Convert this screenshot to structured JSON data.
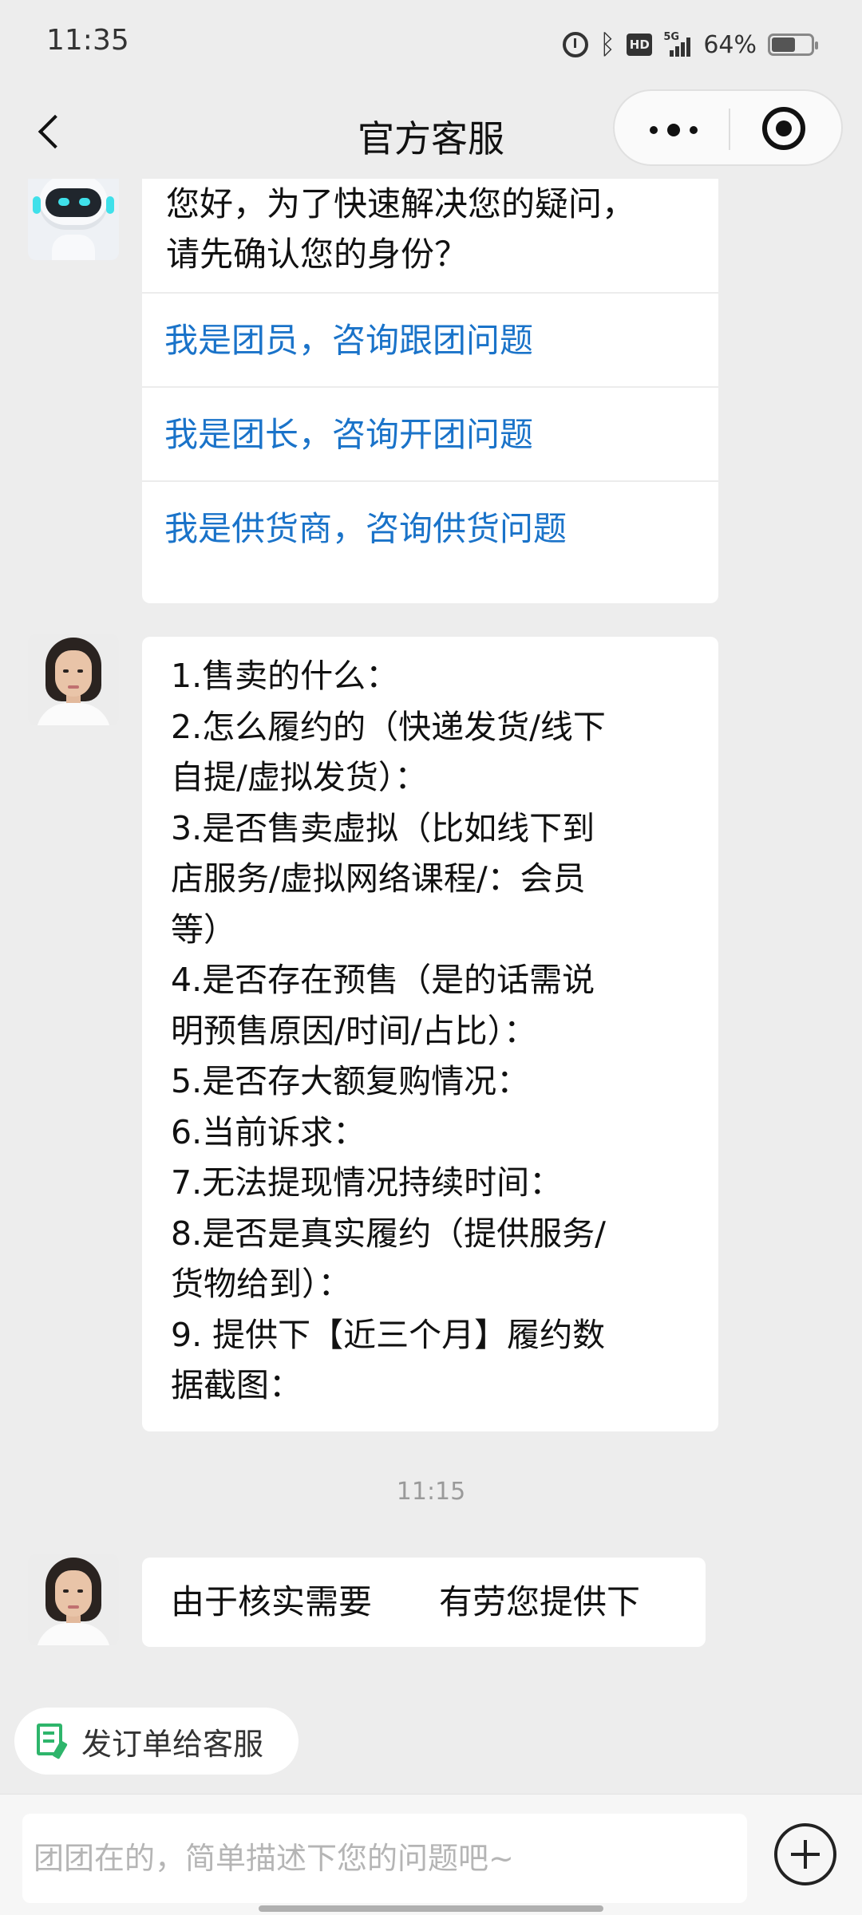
{
  "status_bar": {
    "time": "11:35",
    "network": "5G",
    "hd_label": "HD",
    "battery": "64%",
    "battery_level": 0.64,
    "icons": [
      "alarm-icon",
      "bluetooth-icon",
      "hd-icon",
      "signal-icon",
      "battery-icon"
    ]
  },
  "nav": {
    "title": "官方客服",
    "back_icon": "chevron-left-icon",
    "more_icon": "more-dots-icon",
    "close_icon": "target-close-icon"
  },
  "messages": {
    "greeting": {
      "line1": "您好，为了快速解决您的疑问，",
      "line2": "请先确认您的身份？",
      "options": [
        "我是团员，咨询跟团问题",
        "我是团长，咨询开团问题",
        "我是供货商，咨询供货问题"
      ]
    },
    "checklist": [
      "1.售卖的什么：",
      "2.怎么履约的（快递发货/线下",
      "自提/虚拟发货）：",
      "3.是否售卖虚拟（比如线下到",
      "店服务/虚拟网络课程/：会员",
      "等）",
      "4.是否存在预售（是的话需说",
      "明预售原因/时间/占比）：",
      "5.是否存大额复购情况：",
      "6.当前诉求：",
      "7.无法提现情况持续时间：",
      "8.是否是真实履约（提供服务/",
      "货物给到）：",
      "9.  提供下【近三个月】履约数",
      "据截图："
    ],
    "timestamp": "11:15",
    "last": "由于核实需要　　有劳您提供下"
  },
  "send_order": {
    "label": "发订单给客服",
    "icon": "order-edit-icon",
    "icon_color": "#2eb56b"
  },
  "input": {
    "placeholder": "团团在的，简单描述下您的问题吧~",
    "value": "",
    "plus_icon": "plus-circle-icon"
  },
  "colors": {
    "background": "#ededed",
    "link": "#1a73c9",
    "bubble": "#ffffff"
  }
}
